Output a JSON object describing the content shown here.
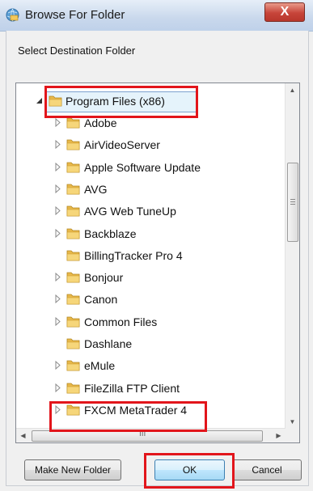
{
  "window": {
    "title": "Browse For Folder",
    "close_glyph": "X",
    "icon": "globe-folder-icon"
  },
  "instruction": "Select Destination Folder",
  "tree": {
    "root": {
      "label": "Program Files (x86)",
      "expanded": true,
      "selected": true
    },
    "items": [
      {
        "label": "Adobe",
        "has_children": true
      },
      {
        "label": "AirVideoServer",
        "has_children": true
      },
      {
        "label": "Apple Software Update",
        "has_children": true
      },
      {
        "label": "AVG",
        "has_children": true
      },
      {
        "label": "AVG Web TuneUp",
        "has_children": true
      },
      {
        "label": "Backblaze",
        "has_children": true
      },
      {
        "label": "BillingTracker Pro 4",
        "has_children": false
      },
      {
        "label": "Bonjour",
        "has_children": true
      },
      {
        "label": "Canon",
        "has_children": true
      },
      {
        "label": "Common Files",
        "has_children": true
      },
      {
        "label": "Dashlane",
        "has_children": false
      },
      {
        "label": "eMule",
        "has_children": true
      },
      {
        "label": "FileZilla FTP Client",
        "has_children": true
      },
      {
        "label": "FXCM MetaTrader 4",
        "has_children": true
      }
    ],
    "hscroll_grip": "III"
  },
  "buttons": {
    "make_new_folder": "Make New Folder",
    "ok": "OK",
    "cancel": "Cancel"
  },
  "annotation_color": "#e2151b"
}
